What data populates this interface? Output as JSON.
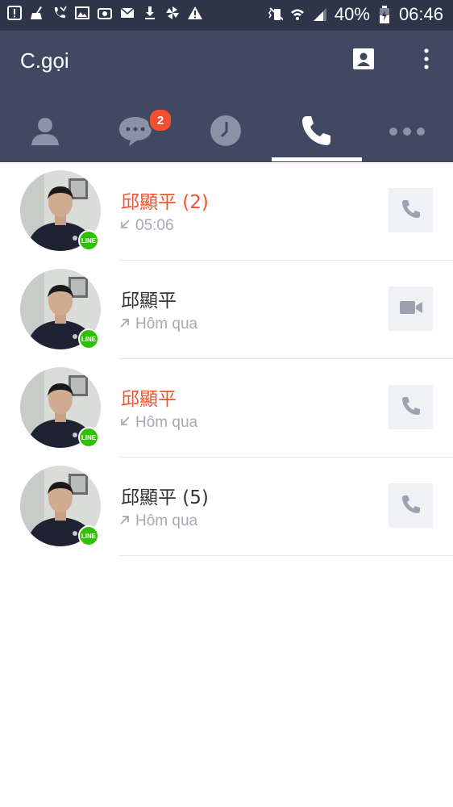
{
  "status_bar": {
    "battery": "40%",
    "time": "06:46",
    "icons_left": [
      "alert-box-icon",
      "broom-icon",
      "missed-call-icon",
      "image-icon",
      "camera-icon",
      "mail-icon",
      "download-icon",
      "pinwheel-icon",
      "warning-icon"
    ],
    "icons_right": [
      "vibrate-mute-icon",
      "wifi-icon",
      "signal-icon",
      "battery-icon"
    ]
  },
  "header": {
    "title": "C.gọi",
    "actions": [
      "contacts-icon",
      "overflow-menu-icon"
    ]
  },
  "tabs": [
    {
      "name": "friends",
      "icon": "person-icon"
    },
    {
      "name": "chats",
      "icon": "chat-bubble-icon",
      "badge": "2"
    },
    {
      "name": "timeline",
      "icon": "clock-icon"
    },
    {
      "name": "calls",
      "icon": "phone-icon",
      "active": true
    },
    {
      "name": "more",
      "icon": "more-dots-icon"
    }
  ],
  "calls": [
    {
      "name": "邱顯平 (2)",
      "time": "05:06",
      "direction": "incoming",
      "missed": true,
      "action": "voice"
    },
    {
      "name": "邱顯平",
      "time": "Hôm qua",
      "direction": "outgoing",
      "missed": false,
      "action": "video"
    },
    {
      "name": "邱顯平",
      "time": "Hôm qua",
      "direction": "incoming",
      "missed": true,
      "action": "voice"
    },
    {
      "name": "邱顯平 (5)",
      "time": "Hôm qua",
      "direction": "outgoing",
      "missed": false,
      "action": "voice"
    }
  ],
  "line_badge_text": "LINE",
  "colors": {
    "statusbar": "#2f3549",
    "header": "#414962",
    "missed": "#f0542d",
    "badge": "#f4502f",
    "line_green": "#2ec100",
    "subtext": "#a7a9b3"
  }
}
